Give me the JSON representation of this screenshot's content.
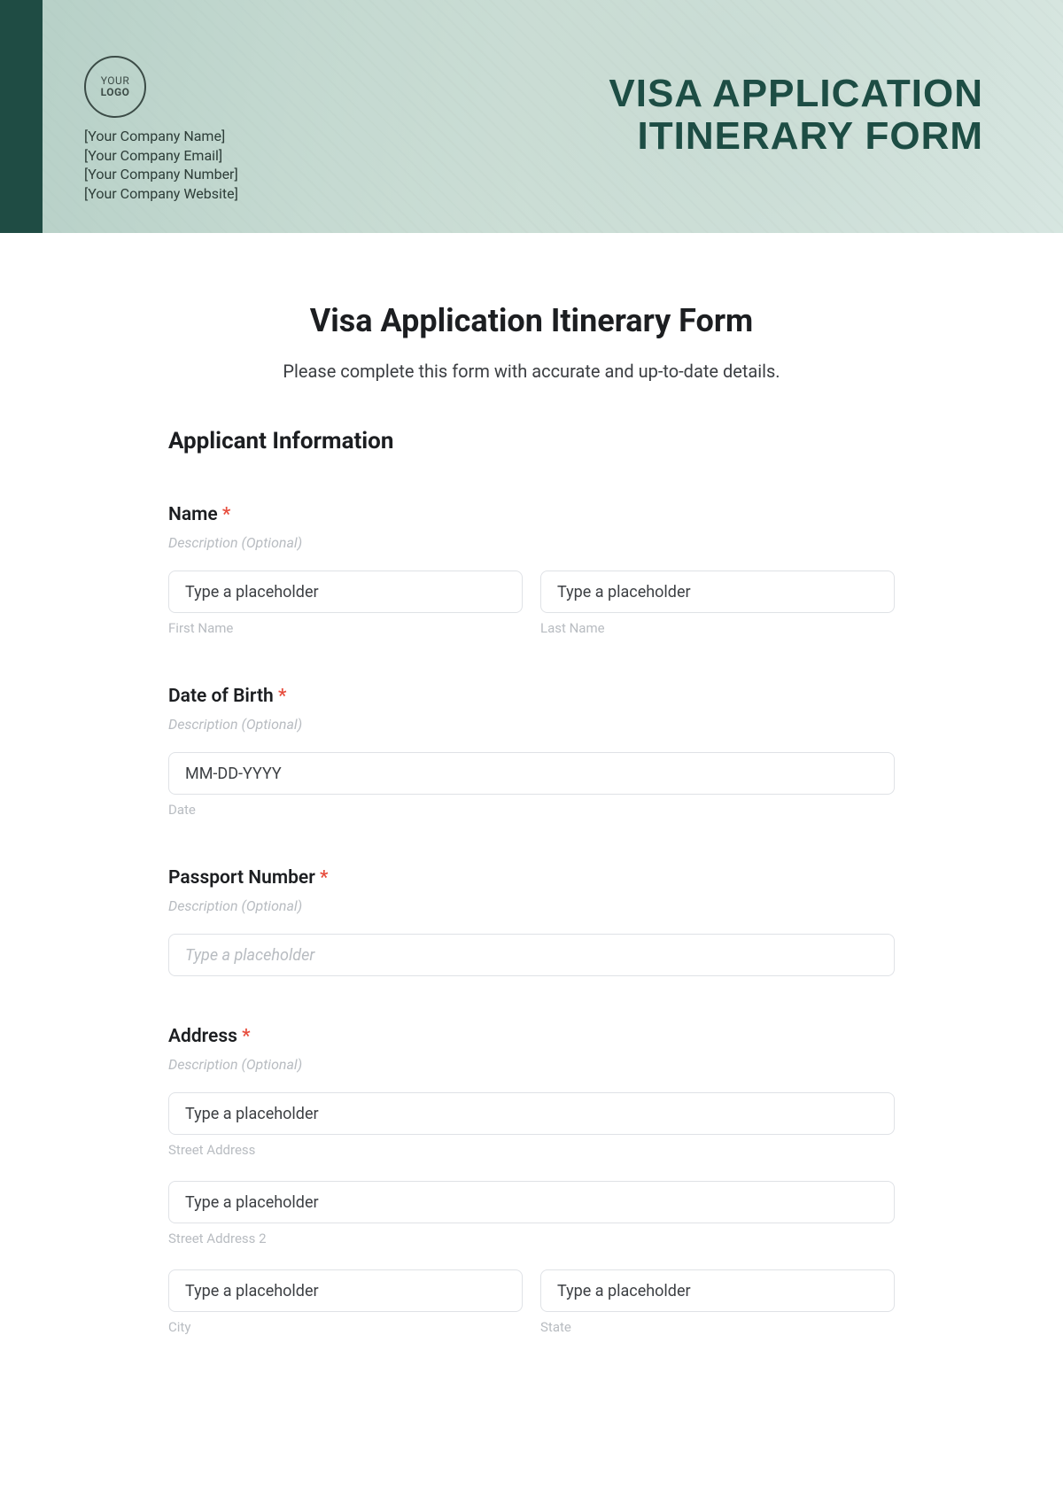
{
  "banner": {
    "logo_line1": "YOUR",
    "logo_line2": "LOGO",
    "company_name": "[Your Company Name]",
    "company_email": "[Your Company Email]",
    "company_number": "[Your Company Number]",
    "company_website": "[Your Company Website]",
    "title_line1": "VISA APPLICATION",
    "title_line2": "ITINERARY FORM"
  },
  "form": {
    "title": "Visa Application Itinerary Form",
    "subtitle": "Please complete this form with accurate and up-to-date details.",
    "section_heading": "Applicant Information",
    "description_optional": "Description (Optional)",
    "required_mark": "*",
    "placeholder_generic": "Type a placeholder",
    "name": {
      "label": "Name",
      "first_sub": "First Name",
      "last_sub": "Last Name"
    },
    "dob": {
      "label": "Date of Birth",
      "placeholder": "MM-DD-YYYY",
      "sub": "Date"
    },
    "passport": {
      "label": "Passport Number"
    },
    "address": {
      "label": "Address",
      "street_sub": "Street Address",
      "street2_sub": "Street Address 2",
      "city_sub": "City",
      "state_sub": "State"
    }
  }
}
